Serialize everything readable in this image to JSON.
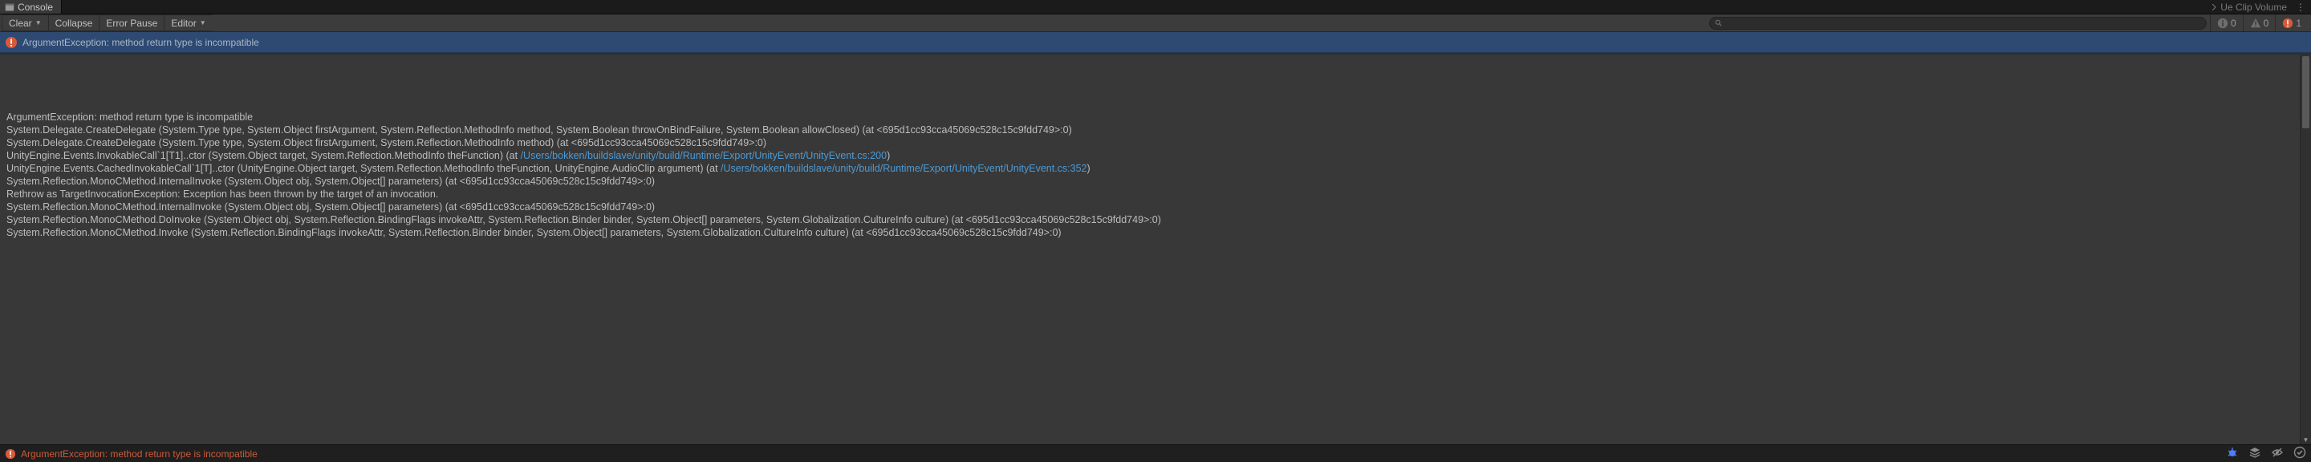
{
  "tabs": {
    "console_label": "Console",
    "right_label": "Ue Clip Volume"
  },
  "toolbar": {
    "clear_label": "Clear",
    "collapse_label": "Collapse",
    "error_pause_label": "Error Pause",
    "editor_label": "Editor",
    "search_placeholder": "",
    "filters": {
      "info_count": "0",
      "warn_count": "0",
      "err_count": "1"
    }
  },
  "loglist": {
    "items": [
      {
        "message": "ArgumentException: method return type is incompatible"
      }
    ]
  },
  "detail": {
    "l0": "ArgumentException: method return type is incompatible",
    "l1": "System.Delegate.CreateDelegate (System.Type type, System.Object firstArgument, System.Reflection.MethodInfo method, System.Boolean throwOnBindFailure, System.Boolean allowClosed) (at <695d1cc93cca45069c528c15c9fdd749>:0)",
    "l2": "System.Delegate.CreateDelegate (System.Type type, System.Object firstArgument, System.Reflection.MethodInfo method) (at <695d1cc93cca45069c528c15c9fdd749>:0)",
    "l3a": "UnityEngine.Events.InvokableCall`1[T1]..ctor (System.Object target, System.Reflection.MethodInfo theFunction) (at ",
    "l3b": "/Users/bokken/buildslave/unity/build/Runtime/Export/UnityEvent/UnityEvent.cs:200",
    "l3c": ")",
    "l4a": "UnityEngine.Events.CachedInvokableCall`1[T]..ctor (UnityEngine.Object target, System.Reflection.MethodInfo theFunction, UnityEngine.AudioClip argument) (at ",
    "l4b": "/Users/bokken/buildslave/unity/build/Runtime/Export/UnityEvent/UnityEvent.cs:352",
    "l4c": ")",
    "l5": "System.Reflection.MonoCMethod.InternalInvoke (System.Object obj, System.Object[] parameters) (at <695d1cc93cca45069c528c15c9fdd749>:0)",
    "l6": "Rethrow as TargetInvocationException: Exception has been thrown by the target of an invocation.",
    "l7": "System.Reflection.MonoCMethod.InternalInvoke (System.Object obj, System.Object[] parameters) (at <695d1cc93cca45069c528c15c9fdd749>:0)",
    "l8": "System.Reflection.MonoCMethod.DoInvoke (System.Object obj, System.Reflection.BindingFlags invokeAttr, System.Reflection.Binder binder, System.Object[] parameters, System.Globalization.CultureInfo culture) (at <695d1cc93cca45069c528c15c9fdd749>:0)",
    "l9": "System.Reflection.MonoCMethod.Invoke (System.Reflection.BindingFlags invokeAttr, System.Reflection.Binder binder, System.Object[] parameters, System.Globalization.CultureInfo culture) (at <695d1cc93cca45069c528c15c9fdd749>:0)"
  },
  "statusbar": {
    "message": "ArgumentException: method return type is incompatible"
  }
}
